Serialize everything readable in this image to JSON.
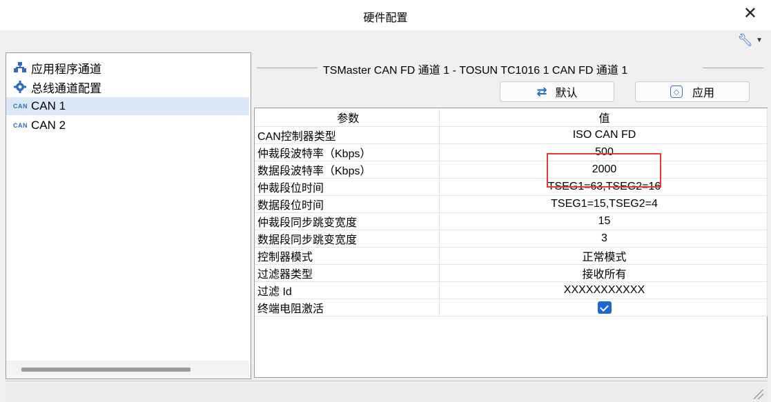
{
  "window": {
    "title": "硬件配置"
  },
  "sidebar": {
    "items": [
      {
        "label": "应用程序通道",
        "icon": "app-channel-icon"
      },
      {
        "label": "总线通道配置",
        "icon": "gear-icon"
      },
      {
        "label": "CAN 1",
        "icon": "can-icon",
        "selected": true
      },
      {
        "label": "CAN 2",
        "icon": "can-icon"
      }
    ],
    "can_icon_text": "CAN"
  },
  "main": {
    "group_title": "TSMaster CAN FD 通道 1 - TOSUN TC1016 1 CAN FD 通道 1",
    "default_button": "默认",
    "apply_button": "应用",
    "table": {
      "headers": [
        "参数",
        "值"
      ],
      "rows": [
        {
          "param": "CAN控制器类型",
          "value": "ISO CAN FD"
        },
        {
          "param": "仲裁段波特率（Kbps）",
          "value": "500"
        },
        {
          "param": "数据段波特率（Kbps）",
          "value": "2000"
        },
        {
          "param": "仲裁段位时间",
          "value": "TSEG1=63,TSEG2=16"
        },
        {
          "param": "数据段位时间",
          "value": "TSEG1=15,TSEG2=4"
        },
        {
          "param": "仲裁段同步跳变宽度",
          "value": "15"
        },
        {
          "param": "数据段同步跳变宽度",
          "value": "3"
        },
        {
          "param": "控制器模式",
          "value": "正常模式"
        },
        {
          "param": "过滤器类型",
          "value": "接收所有"
        },
        {
          "param": "过滤 Id",
          "value": "XXXXXXXXXXX"
        },
        {
          "param": "终端电阻激活",
          "value": "",
          "checked": true
        }
      ]
    }
  },
  "colors": {
    "accent": "#1c66d6",
    "highlight": "#e53935",
    "selection": "#dbe8f8"
  }
}
